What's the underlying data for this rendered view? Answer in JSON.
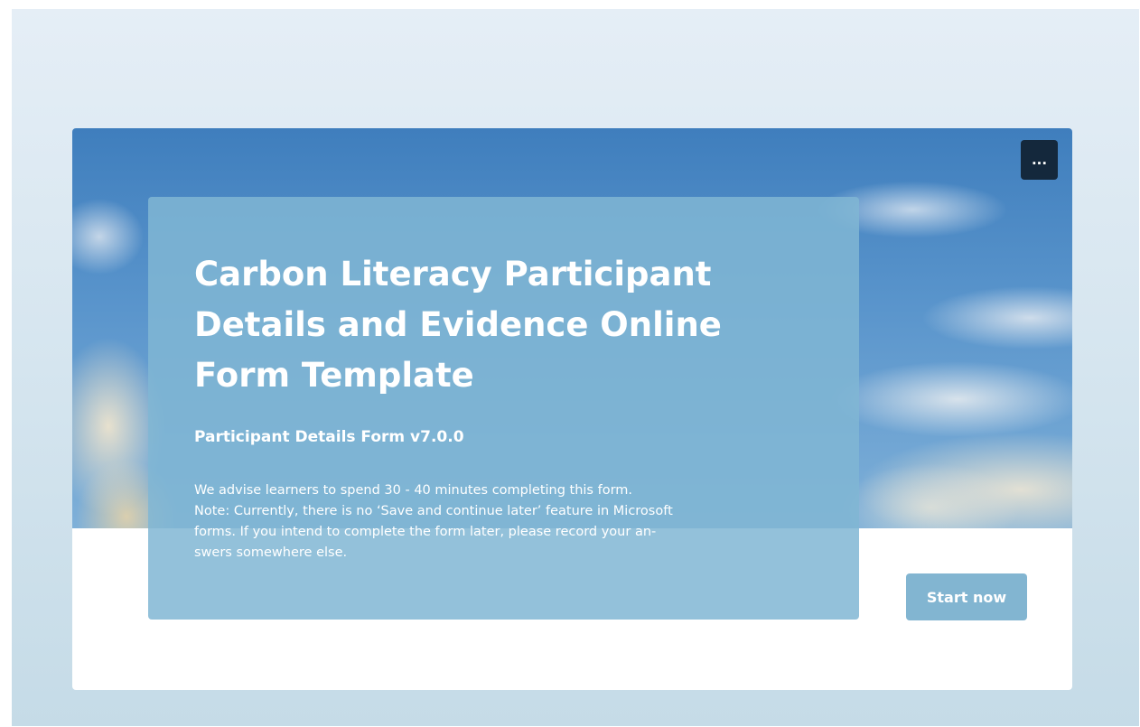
{
  "header": {
    "more_options_label": "..."
  },
  "intro": {
    "title": "Carbon Literacy Participant Details and Evidence Online Form Template",
    "subtitle": "Participant Details Form v7.0.0",
    "description_lines": [
      "We advise learners to spend 30 - 40 minutes completing this form.",
      "Note: Currently, there is no ‘Save and continue later’ feature in Microsoft",
      "forms. If you intend to complete the form later, please record your an-",
      "swers somewhere else."
    ]
  },
  "actions": {
    "start_label": "Start now"
  },
  "colors": {
    "background": "#dbe8f1",
    "panel": "#80b6d4",
    "start_button": "#82b5d1",
    "more_button": "#14283c",
    "text": "#ffffff"
  },
  "icons": {
    "more_options": "more-horizontal-icon"
  }
}
